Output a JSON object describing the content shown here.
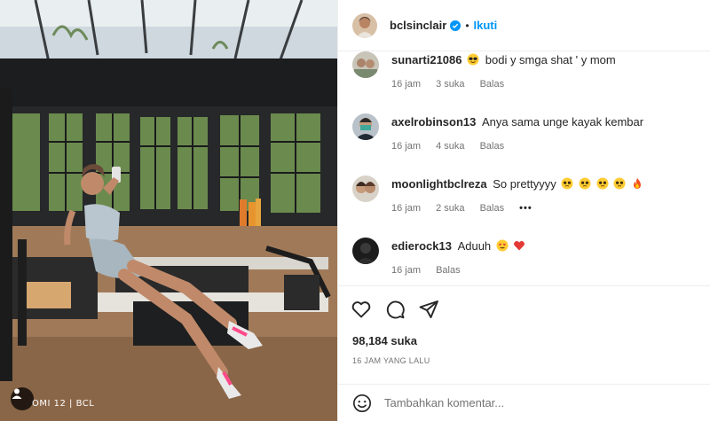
{
  "post": {
    "author": "bclsinclair",
    "follow_label": "Ikuti",
    "separator": "•",
    "media_caption": "OMI 12 | BCL",
    "likes": "98,184 suka",
    "posted": "16 JAM YANG LALU"
  },
  "comments": [
    {
      "user": "sunarti21086",
      "text": "bodi y smga shat ' y mom",
      "emoji_before": [
        "sunglasses"
      ],
      "emoji_after": [],
      "time": "16 jam",
      "likes": "3 suka",
      "reply": "Balas",
      "more": ""
    },
    {
      "user": "axelrobinson13",
      "text": "Anya sama unge kayak kembar",
      "emoji_before": [],
      "emoji_after": [],
      "time": "16 jam",
      "likes": "4 suka",
      "reply": "Balas",
      "more": ""
    },
    {
      "user": "moonlightbclreza",
      "text": "So prettyyyy",
      "emoji_before": [],
      "emoji_after": [
        "pleading",
        "pleading",
        "pleading",
        "pleading",
        "fire"
      ],
      "time": "16 jam",
      "likes": "2 suka",
      "reply": "Balas",
      "more": "•••"
    },
    {
      "user": "edierock13",
      "text": "Aduuh",
      "emoji_before": [],
      "emoji_after": [
        "heart-eyes",
        "red-heart"
      ],
      "time": "16 jam",
      "likes": "",
      "reply": "Balas",
      "more": ""
    }
  ],
  "input": {
    "placeholder": "Tambahkan komentar..."
  },
  "icons": [
    "like-icon",
    "comment-icon",
    "share-icon",
    "emoji-icon",
    "tag-user-icon",
    "verified-badge-icon"
  ],
  "colors": {
    "follow": "#0095f6",
    "verified": "#0095f6",
    "meta": "#737373"
  }
}
